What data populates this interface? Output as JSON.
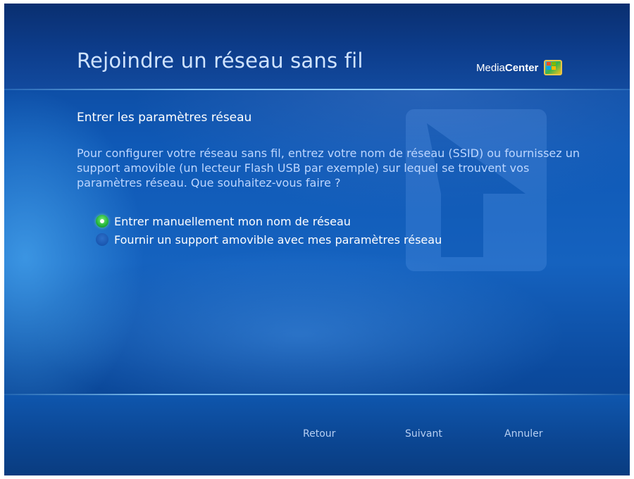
{
  "header": {
    "title": "Rejoindre un réseau sans fil",
    "logo": {
      "prefix": "Media",
      "bold": "Center",
      "icon": "windows-flag-icon"
    }
  },
  "content": {
    "subtitle": "Entrer les paramètres réseau",
    "description": "Pour configurer votre réseau sans fil, entrez votre nom de réseau (SSID) ou fournissez un support amovible (un lecteur Flash USB par exemple) sur lequel se trouvent vos paramètres réseau. Que souhaitez-vous faire ?",
    "options": [
      {
        "label": "Entrer manuellement mon nom de réseau",
        "selected": true
      },
      {
        "label": "Fournir un support amovible avec mes paramètres réseau",
        "selected": false
      }
    ]
  },
  "footer": {
    "back_label": "Retour",
    "next_label": "Suivant",
    "cancel_label": "Annuler"
  },
  "colors": {
    "background_blue": "#1562bf",
    "title_text": "#cfe3ff",
    "selected_radio": "#22b33a"
  }
}
